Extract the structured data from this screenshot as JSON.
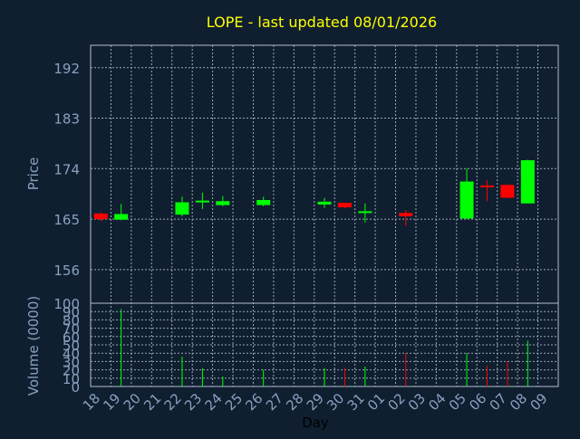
{
  "colors": {
    "background": "#0f1f30",
    "axis_text": "#8aa0c0",
    "title": "#ffff00",
    "grid": "#9aa8b8",
    "frame": "#b0bccc",
    "up": "#00ff00",
    "down": "#ff0000"
  },
  "chart_data": [
    {
      "type": "candlestick",
      "title": "LOPE - last updated 08/01/2026",
      "ylabel": "Price",
      "ylim": [
        150,
        196
      ],
      "y_ticks": [
        "156",
        "165",
        "174",
        "183",
        "192"
      ],
      "grid": true,
      "candles": [
        {
          "day": "18",
          "open": 165.0,
          "high": 166.2,
          "low": 164.6,
          "close": 166.0,
          "direction": "down"
        },
        {
          "day": "19",
          "open": 164.9,
          "high": 167.7,
          "low": 164.8,
          "close": 165.9,
          "direction": "up"
        },
        {
          "day": "22",
          "open": 165.8,
          "high": 169.0,
          "low": 165.5,
          "close": 168.0,
          "direction": "up"
        },
        {
          "day": "23",
          "open": 168.0,
          "high": 169.7,
          "low": 166.8,
          "close": 168.3,
          "direction": "up"
        },
        {
          "day": "24",
          "open": 167.5,
          "high": 169.1,
          "low": 167.3,
          "close": 168.2,
          "direction": "up"
        },
        {
          "day": "26",
          "open": 167.5,
          "high": 169.0,
          "low": 167.3,
          "close": 168.4,
          "direction": "up"
        },
        {
          "day": "29",
          "open": 167.6,
          "high": 168.8,
          "low": 167.0,
          "close": 168.1,
          "direction": "up"
        },
        {
          "day": "30",
          "open": 167.9,
          "high": 167.9,
          "low": 166.9,
          "close": 167.1,
          "direction": "down"
        },
        {
          "day": "31",
          "open": 166.2,
          "high": 167.8,
          "low": 164.4,
          "close": 166.4,
          "direction": "up"
        },
        {
          "day": "02",
          "open": 166.1,
          "high": 166.6,
          "low": 163.8,
          "close": 165.5,
          "direction": "down"
        },
        {
          "day": "05",
          "open": 165.1,
          "high": 174.0,
          "low": 165.0,
          "close": 171.7,
          "direction": "up"
        },
        {
          "day": "06",
          "open": 171.0,
          "high": 171.9,
          "low": 168.2,
          "close": 170.8,
          "direction": "down"
        },
        {
          "day": "07",
          "open": 171.1,
          "high": 171.2,
          "low": 168.8,
          "close": 168.8,
          "direction": "down"
        },
        {
          "day": "08",
          "open": 167.8,
          "high": 175.6,
          "low": 167.8,
          "close": 175.5,
          "direction": "up"
        }
      ]
    },
    {
      "type": "bar",
      "ylabel": "Volume (0000)",
      "xlabel": "Day",
      "ylim": [
        0,
        100
      ],
      "y_ticks": [
        "0",
        "10",
        "20",
        "30",
        "40",
        "50",
        "60",
        "70",
        "80",
        "90",
        "100"
      ],
      "categories": [
        "18",
        "19",
        "20",
        "21",
        "22",
        "23",
        "24",
        "25",
        "26",
        "27",
        "28",
        "29",
        "30",
        "31",
        "01",
        "02",
        "03",
        "04",
        "05",
        "06",
        "07",
        "08",
        "09"
      ],
      "bars": [
        {
          "day": "19",
          "value": 93,
          "direction": "up"
        },
        {
          "day": "22",
          "value": 36,
          "direction": "up"
        },
        {
          "day": "23",
          "value": 22,
          "direction": "up"
        },
        {
          "day": "24",
          "value": 12,
          "direction": "up"
        },
        {
          "day": "26",
          "value": 20,
          "direction": "up"
        },
        {
          "day": "29",
          "value": 22,
          "direction": "up"
        },
        {
          "day": "30",
          "value": 22,
          "direction": "down"
        },
        {
          "day": "31",
          "value": 24,
          "direction": "up"
        },
        {
          "day": "02",
          "value": 40,
          "direction": "down"
        },
        {
          "day": "05",
          "value": 40,
          "direction": "up"
        },
        {
          "day": "06",
          "value": 25,
          "direction": "down"
        },
        {
          "day": "07",
          "value": 30,
          "direction": "down"
        },
        {
          "day": "08",
          "value": 55,
          "direction": "up"
        }
      ]
    }
  ]
}
